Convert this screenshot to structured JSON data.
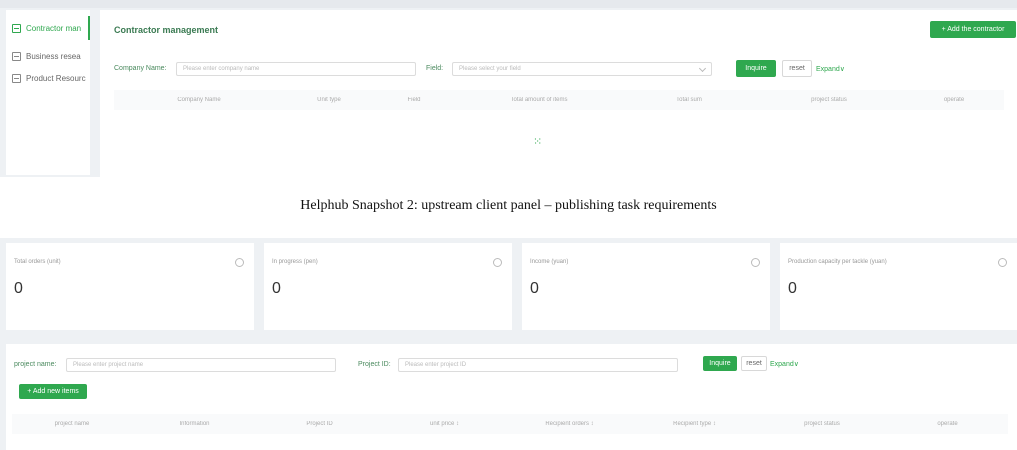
{
  "snapshot1": {
    "sidebar": {
      "items": [
        {
          "label": "Contractor man",
          "active": true
        },
        {
          "label": "Business resea",
          "active": false
        },
        {
          "label": "Product Resourc",
          "active": false
        }
      ]
    },
    "header": {
      "title": "Contractor management",
      "add_button": "+ Add the contractor"
    },
    "search": {
      "company_label": "Company Name:",
      "company_placeholder": "Please enter company name",
      "field_label": "Field:",
      "field_placeholder": "Please select your field",
      "inquire": "Inquire",
      "reset": "reset",
      "expand": "Expand∨"
    },
    "table": {
      "columns": [
        "Company Name",
        "Unit type",
        "Field",
        "Total amount of items",
        "Total sum",
        "project status",
        "operate"
      ]
    },
    "empty_icon": "loading-dots-icon"
  },
  "caption": "Helphub Snapshot 2: upstream client panel –  publishing task requirements",
  "snapshot2": {
    "cards": [
      {
        "label": "Total orders (unit)",
        "value": "0"
      },
      {
        "label": "In progress (pen)",
        "value": "0"
      },
      {
        "label": "Income (yuan)",
        "value": "0"
      },
      {
        "label": "Production capacity per tackle (yuan)",
        "value": "0"
      }
    ],
    "search": {
      "project_name_label": "project name:",
      "project_name_placeholder": "Please enter project name",
      "project_id_label": "Project ID:",
      "project_id_placeholder": "Please enter project ID",
      "inquire": "Inquire",
      "reset": "reset",
      "expand": "Expand∨",
      "add_button": "+ Add new items"
    },
    "table": {
      "columns": [
        "project name",
        "Information",
        "Project ID",
        "unit price ↕",
        "Recipient orders ↕",
        "Recipient type ↕",
        "project status",
        "operate"
      ]
    }
  },
  "colors": {
    "accent": "#2fa84f",
    "background": "#eef1f4"
  }
}
